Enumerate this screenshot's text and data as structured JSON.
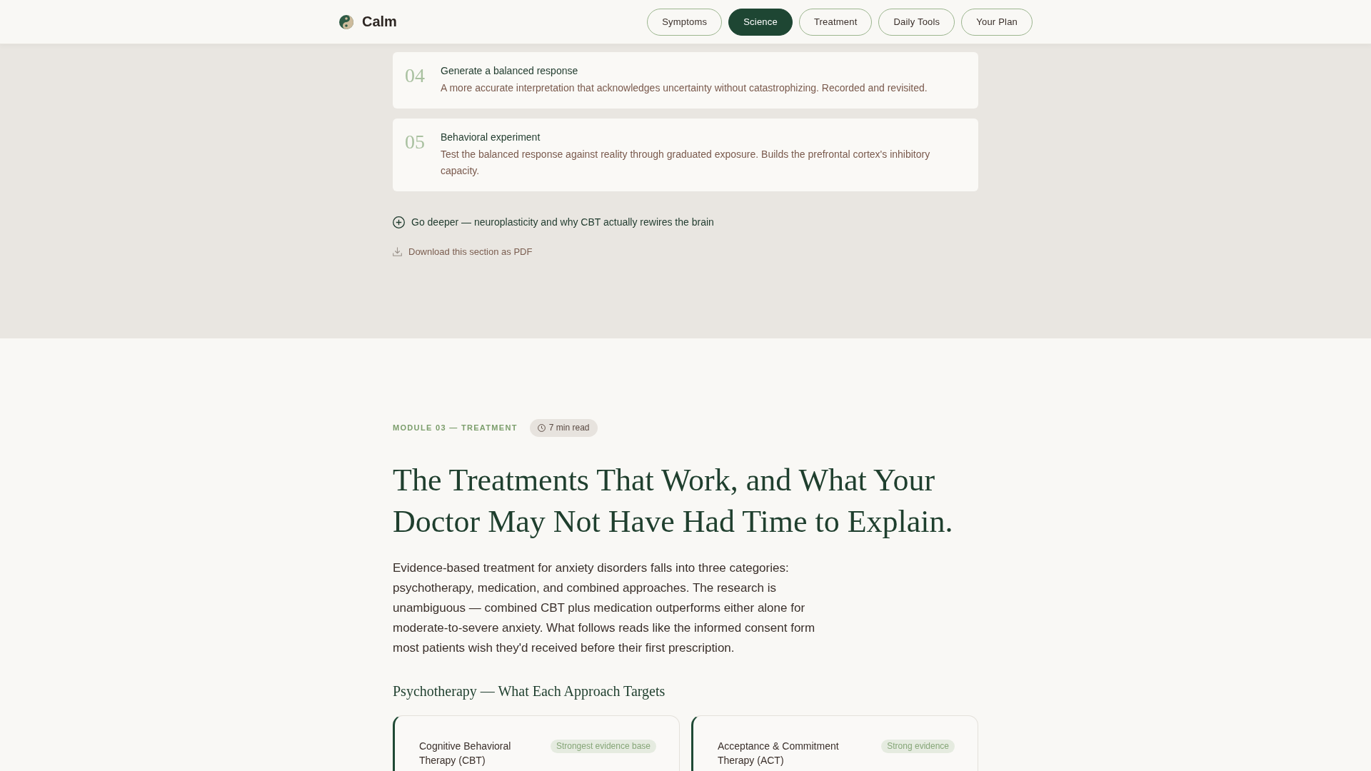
{
  "header": {
    "brand": "Calm",
    "nav": [
      {
        "label": "Symptoms",
        "selected": false
      },
      {
        "label": "Science",
        "selected": true
      },
      {
        "label": "Treatment",
        "selected": false
      },
      {
        "label": "Daily Tools",
        "selected": false
      },
      {
        "label": "Your Plan",
        "selected": false
      }
    ]
  },
  "steps": [
    {
      "number": "04",
      "title": "Generate a balanced response",
      "description": "A more accurate interpretation that acknowledges uncertainty without catastrophizing. Recorded and revisited."
    },
    {
      "number": "05",
      "title": "Behavioral experiment",
      "description": "Test the balanced response against reality through graduated exposure. Builds the prefrontal cortex's inhibitory capacity."
    }
  ],
  "links": {
    "expand": "Go deeper — neuroplasticity and why CBT actually rewires the brain",
    "download": "Download this section as PDF"
  },
  "module": {
    "eyebrow": "MODULE 03 — TREATMENT",
    "read_time": "7 min read",
    "title": "The Treatments That Work, and What Your Doctor May Not Have Had Time to Explain.",
    "intro": "Evidence-based treatment for anxiety disorders falls into three categories: psychotherapy, medication, and combined approaches. The research is unambiguous — combined CBT plus medication outperforms either alone for moderate-to-severe anxiety. What follows reads like the informed consent form most patients wish they'd received before their first prescription.",
    "subheading": "Psychotherapy — What Each Approach Targets",
    "approaches": [
      {
        "name": "Cognitive Behavioral Therapy (CBT)",
        "evidence": "Strongest evidence base"
      },
      {
        "name": "Acceptance & Commitment Therapy (ACT)",
        "evidence": "Strong evidence"
      }
    ]
  }
}
